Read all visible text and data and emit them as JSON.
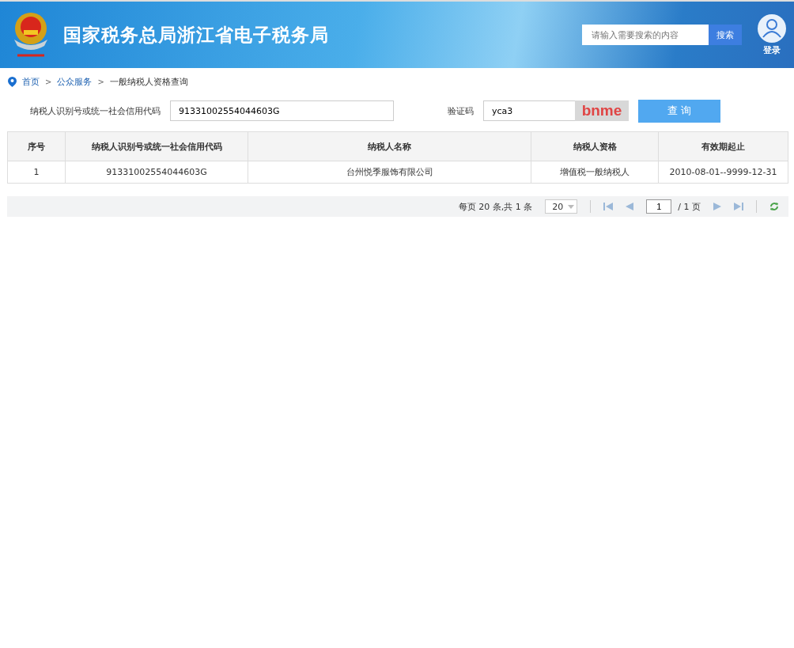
{
  "header": {
    "title": "国家税务总局浙江省电子税务局",
    "search": {
      "placeholder": "请输入需要搜索的内容",
      "button": "搜索"
    },
    "login": "登录"
  },
  "breadcrumb": [
    {
      "label": "首页",
      "link": true
    },
    {
      "label": "公众服务",
      "link": true
    },
    {
      "label": "一般纳税人资格查询",
      "link": false
    }
  ],
  "breadcrumb_separator": ">",
  "form": {
    "id_label": "纳税人识别号或统一社会信用代码",
    "id_value": "91331002554044603G",
    "captcha_label": "验证码",
    "captcha_value": "yca3",
    "captcha_image": "bnme",
    "submit": "查 询"
  },
  "table": {
    "columns": [
      "序号",
      "纳税人识别号或统一社会信用代码",
      "纳税人名称",
      "纳税人资格",
      "有效期起止"
    ],
    "rows": [
      [
        "1",
        "91331002554044603G",
        "台州悦季服饰有限公司",
        "增值税一般纳税人",
        "2010-08-01--9999-12-31"
      ]
    ]
  },
  "pager": {
    "summary": "每页 20 条,共 1 条",
    "page_size": "20",
    "page": "1",
    "total_pages": "/ 1 页"
  }
}
